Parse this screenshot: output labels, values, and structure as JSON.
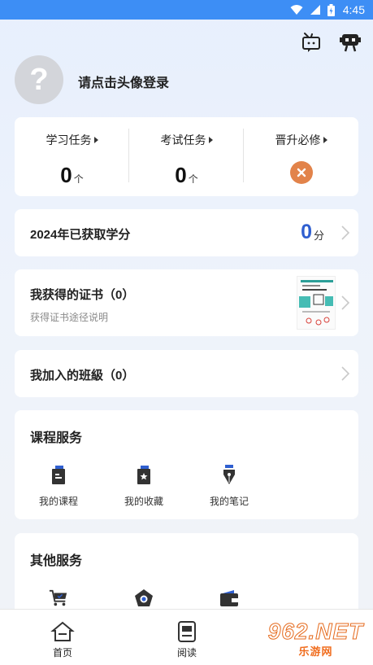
{
  "status_bar": {
    "time": "4:45",
    "colors": {
      "bg": "#3d8ef5"
    }
  },
  "header": {
    "icons": [
      "message-tv-icon",
      "robot-icon"
    ]
  },
  "profile": {
    "avatar_glyph": "?",
    "login_prompt": "请点击头像登录"
  },
  "tasks": [
    {
      "label": "学习任务",
      "value": "0",
      "unit": "个"
    },
    {
      "label": "考试任务",
      "value": "0",
      "unit": "个"
    },
    {
      "label": "晋升必修",
      "status_icon": "close-circle-icon"
    }
  ],
  "credits": {
    "title": "2024年已获取学分",
    "value": "0",
    "unit": "分",
    "value_color": "#2f5fd0"
  },
  "certificates": {
    "title": "我获得的证书（0）",
    "subtitle": "获得证书途径说明"
  },
  "classes": {
    "title": "我加入的班級（0）"
  },
  "course_services": {
    "title": "课程服务",
    "items": [
      {
        "label": "我的课程",
        "icon": "course-book-icon"
      },
      {
        "label": "我的收藏",
        "icon": "favorite-book-icon"
      },
      {
        "label": "我的笔记",
        "icon": "pen-nib-icon"
      }
    ]
  },
  "other_services": {
    "title": "其他服务",
    "items": [
      {
        "icon": "shopping-cart-icon"
      },
      {
        "icon": "shield-dot-icon"
      },
      {
        "icon": "wallet-icon"
      }
    ]
  },
  "bottom_nav": [
    {
      "label": "首页",
      "icon": "home-icon"
    },
    {
      "label": "阅读",
      "icon": "reading-icon"
    }
  ],
  "watermark": {
    "top": "962.NET",
    "bottom": "乐游网"
  }
}
